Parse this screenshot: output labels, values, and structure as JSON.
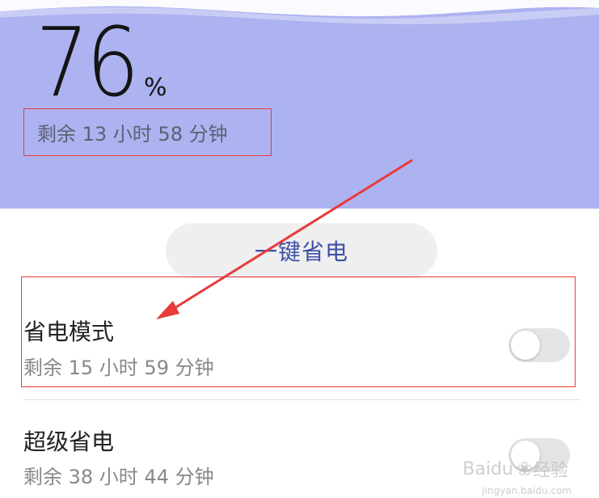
{
  "battery": {
    "percent_value": "76",
    "percent_sign": "%",
    "remaining": "剩余 13 小时 58 分钟"
  },
  "one_key_button": {
    "label": "一键省电"
  },
  "modes": [
    {
      "title": "省电模式",
      "remaining": "剩余 15 小时 59 分钟",
      "enabled": false
    },
    {
      "title": "超级省电",
      "remaining": "剩余 38 小时 44 分钟",
      "enabled": false
    }
  ],
  "watermark": {
    "brand": "Baidu",
    "brand_suffix": "经验",
    "url": "jingyan.baidu.com"
  },
  "colors": {
    "header_bg": "#adb3f0",
    "annotation": "#e83b3b",
    "button_text": "#3d4fa6"
  }
}
